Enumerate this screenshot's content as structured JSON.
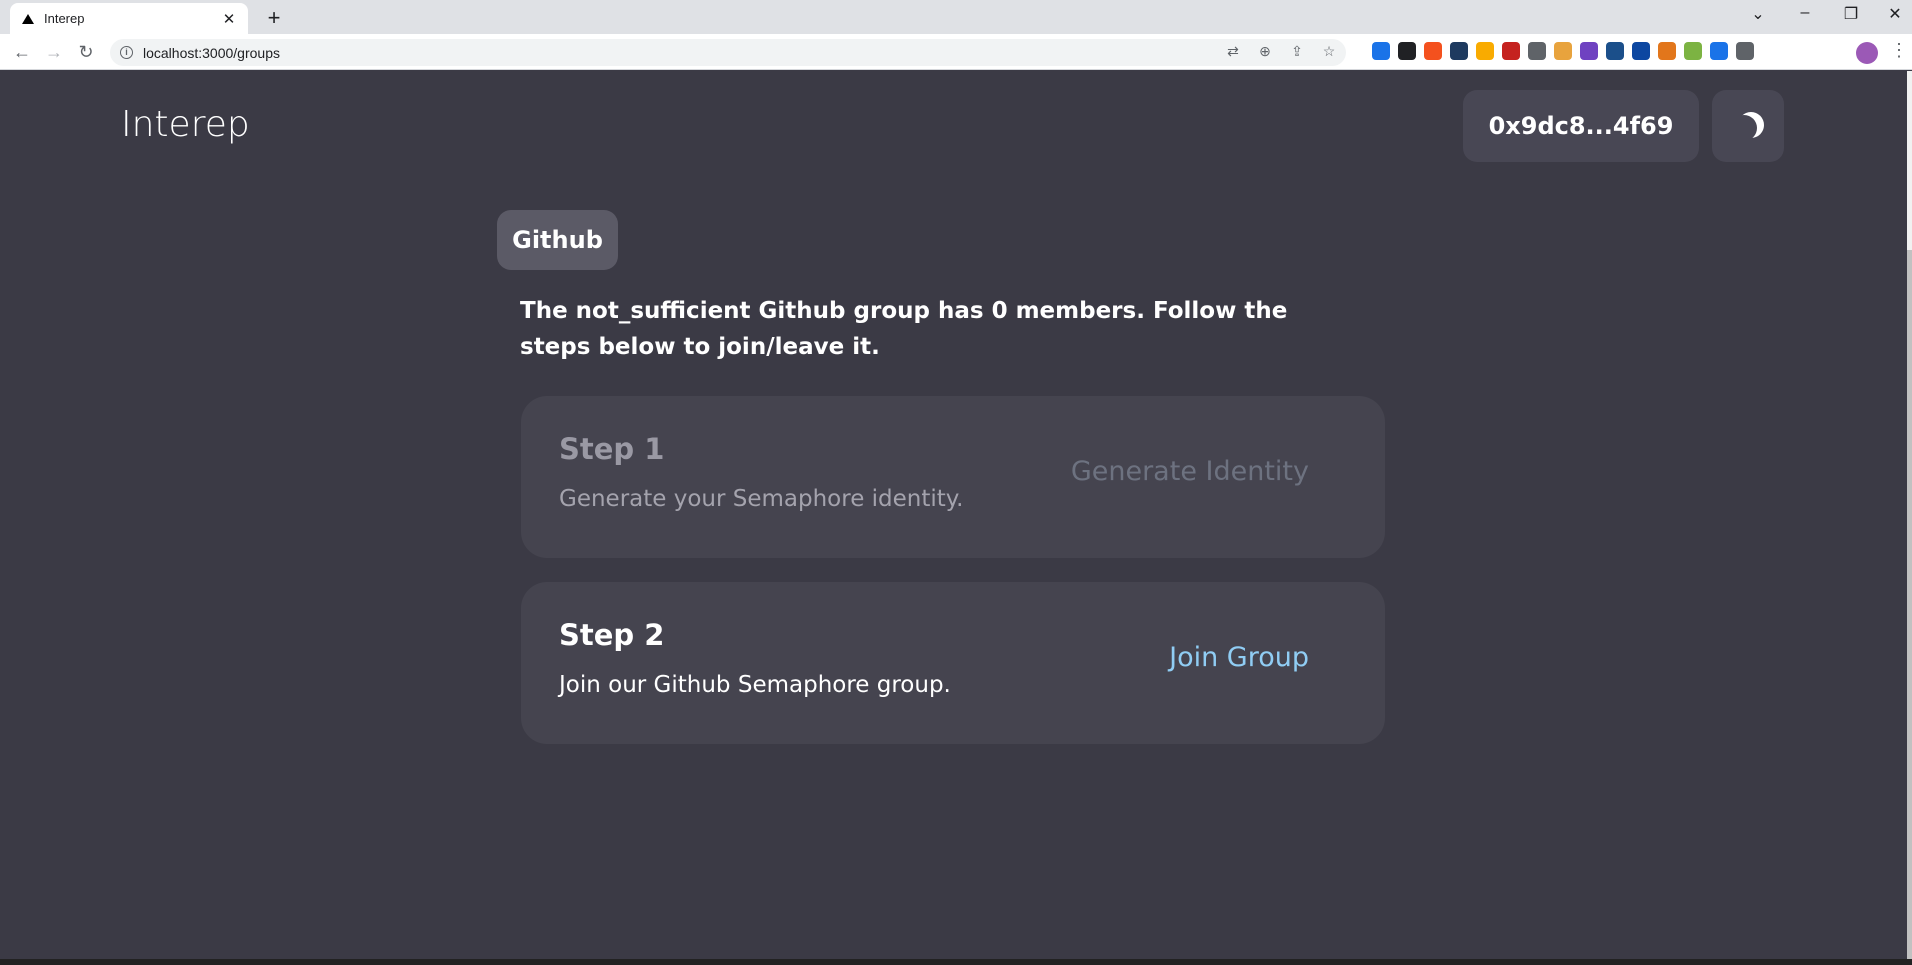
{
  "browser": {
    "tab_title": "Interep",
    "tab_close": "✕",
    "new_tab": "+",
    "url": "localhost:3000/groups",
    "window_controls": {
      "collapse": "⌄",
      "minimize": "–",
      "restore": "❐",
      "close": "✕"
    },
    "extension_colors": [
      "#1a73e8",
      "#202124",
      "#f4511e",
      "#1e3a5f",
      "#f9ab00",
      "#c5221f",
      "#5f6368",
      "#e8a33d",
      "#6f42c1",
      "#1b4f8a",
      "#0d47a1",
      "#e2761b",
      "#7cb342",
      "#1a73e8",
      "#5f6368"
    ]
  },
  "header": {
    "brand": "Interep",
    "address": "0x9dc8...4f69",
    "theme_icon": "moon-icon"
  },
  "group": {
    "provider": "Github",
    "description": "The not_sufficient Github group has 0 members. Follow the steps below to join/leave it."
  },
  "steps": [
    {
      "title": "Step 1",
      "text": "Generate your Semaphore identity.",
      "action": "Generate Identity",
      "enabled": false
    },
    {
      "title": "Step 2",
      "text": "Join our Github Semaphore group.",
      "action": "Join Group",
      "enabled": true
    }
  ],
  "colors": {
    "background": "#3b3a45",
    "card": "#45444f",
    "accent": "#90cdf4"
  }
}
